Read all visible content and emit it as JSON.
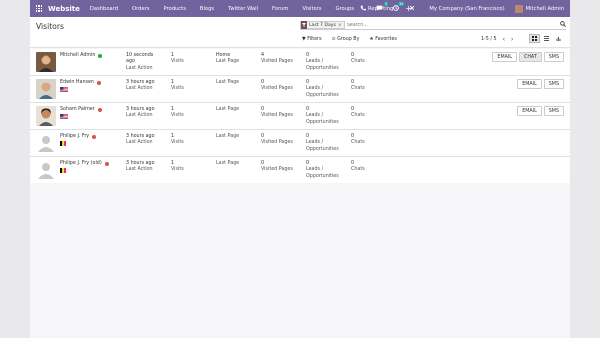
{
  "navbar": {
    "app_name": "Website",
    "menu": [
      "Dashboard",
      "Orders",
      "Products",
      "Blogs",
      "Twitter Wall",
      "Forum",
      "Visitors",
      "Groups",
      "Reporting"
    ],
    "plus": "+",
    "icons": [
      "phone-icon",
      "chat-icon",
      "activity-icon",
      "close-icon"
    ],
    "chat_badge": "5",
    "activity_badge": "35",
    "company": "My Company (San Francisco)",
    "user": "Mitchell Admin"
  },
  "control": {
    "title": "Visitors",
    "facet": "Last 7 Days",
    "facet_close": "×",
    "search_placeholder": "Search...",
    "filters": "Filters",
    "group_by": "Group By",
    "favorites": "Favorites",
    "pager": "1-5 / 5"
  },
  "visitors": [
    {
      "name": "Mitchell Admin",
      "status_color": "#28a745",
      "flag": "none",
      "photo": "man1",
      "last_action_value": "10 seconds ago",
      "last_action_label": "Last Action",
      "visits_value": "1",
      "visits_label": "Visits",
      "last_page_value": "Home",
      "last_page_label": "Last Page",
      "visited_pages_value": "4",
      "visited_pages_label": "Visited Pages",
      "leads_value": "0",
      "leads_label": "Leads / Opportunities",
      "chats_value": "0",
      "chats_label": "Chats",
      "buttons": [
        "EMAIL",
        "CHAT",
        "SMS"
      ]
    },
    {
      "name": "Edwin Hansen",
      "status_color": "#d9534f",
      "flag": "us",
      "photo": "man2",
      "last_action_value": "3 hours ago",
      "last_action_label": "Last Action",
      "visits_value": "1",
      "visits_label": "Visits",
      "last_page_value": "",
      "last_page_label": "Last Page",
      "visited_pages_value": "0",
      "visited_pages_label": "Visited Pages",
      "leads_value": "0",
      "leads_label": "Leads / Opportunities",
      "chats_value": "0",
      "chats_label": "Chats",
      "buttons": [
        "EMAIL",
        "SMS"
      ]
    },
    {
      "name": "Soham Palmer",
      "status_color": "#d9534f",
      "flag": "us",
      "photo": "man3",
      "last_action_value": "3 hours ago",
      "last_action_label": "Last Action",
      "visits_value": "1",
      "visits_label": "Visits",
      "last_page_value": "",
      "last_page_label": "Last Page",
      "visited_pages_value": "0",
      "visited_pages_label": "Visited Pages",
      "leads_value": "0",
      "leads_label": "Leads / Opportunities",
      "chats_value": "0",
      "chats_label": "Chats",
      "buttons": [
        "EMAIL",
        "SMS"
      ]
    },
    {
      "name": "Philipe J. Fry",
      "status_color": "#d9534f",
      "flag": "be",
      "photo": "placeholder",
      "last_action_value": "3 hours ago",
      "last_action_label": "Last Action",
      "visits_value": "1",
      "visits_label": "Visits",
      "last_page_value": "",
      "last_page_label": "Last Page",
      "visited_pages_value": "0",
      "visited_pages_label": "Visited Pages",
      "leads_value": "0",
      "leads_label": "Leads / Opportunities",
      "chats_value": "0",
      "chats_label": "Chats",
      "buttons": []
    },
    {
      "name": "Philipe J. Fry (old)",
      "status_color": "#d9534f",
      "flag": "be",
      "photo": "placeholder",
      "last_action_value": "3 hours ago",
      "last_action_label": "Last Action",
      "visits_value": "1",
      "visits_label": "Visits",
      "last_page_value": "",
      "last_page_label": "Last Page",
      "visited_pages_value": "0",
      "visited_pages_label": "Visited Pages",
      "leads_value": "0",
      "leads_label": "Leads / Opportunities",
      "chats_value": "0",
      "chats_label": "Chats",
      "buttons": []
    }
  ],
  "colors": {
    "navbar": "#71639e",
    "online": "#28a745",
    "offline": "#d9534f"
  }
}
